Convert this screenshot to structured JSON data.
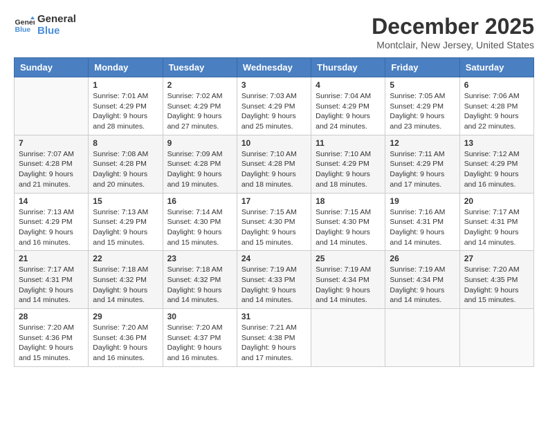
{
  "header": {
    "logo_line1": "General",
    "logo_line2": "Blue",
    "month": "December 2025",
    "location": "Montclair, New Jersey, United States"
  },
  "weekdays": [
    "Sunday",
    "Monday",
    "Tuesday",
    "Wednesday",
    "Thursday",
    "Friday",
    "Saturday"
  ],
  "weeks": [
    [
      {
        "day": "",
        "sunrise": "",
        "sunset": "",
        "daylight": ""
      },
      {
        "day": "1",
        "sunrise": "Sunrise: 7:01 AM",
        "sunset": "Sunset: 4:29 PM",
        "daylight": "Daylight: 9 hours and 28 minutes."
      },
      {
        "day": "2",
        "sunrise": "Sunrise: 7:02 AM",
        "sunset": "Sunset: 4:29 PM",
        "daylight": "Daylight: 9 hours and 27 minutes."
      },
      {
        "day": "3",
        "sunrise": "Sunrise: 7:03 AM",
        "sunset": "Sunset: 4:29 PM",
        "daylight": "Daylight: 9 hours and 25 minutes."
      },
      {
        "day": "4",
        "sunrise": "Sunrise: 7:04 AM",
        "sunset": "Sunset: 4:29 PM",
        "daylight": "Daylight: 9 hours and 24 minutes."
      },
      {
        "day": "5",
        "sunrise": "Sunrise: 7:05 AM",
        "sunset": "Sunset: 4:29 PM",
        "daylight": "Daylight: 9 hours and 23 minutes."
      },
      {
        "day": "6",
        "sunrise": "Sunrise: 7:06 AM",
        "sunset": "Sunset: 4:28 PM",
        "daylight": "Daylight: 9 hours and 22 minutes."
      }
    ],
    [
      {
        "day": "7",
        "sunrise": "Sunrise: 7:07 AM",
        "sunset": "Sunset: 4:28 PM",
        "daylight": "Daylight: 9 hours and 21 minutes."
      },
      {
        "day": "8",
        "sunrise": "Sunrise: 7:08 AM",
        "sunset": "Sunset: 4:28 PM",
        "daylight": "Daylight: 9 hours and 20 minutes."
      },
      {
        "day": "9",
        "sunrise": "Sunrise: 7:09 AM",
        "sunset": "Sunset: 4:28 PM",
        "daylight": "Daylight: 9 hours and 19 minutes."
      },
      {
        "day": "10",
        "sunrise": "Sunrise: 7:10 AM",
        "sunset": "Sunset: 4:28 PM",
        "daylight": "Daylight: 9 hours and 18 minutes."
      },
      {
        "day": "11",
        "sunrise": "Sunrise: 7:10 AM",
        "sunset": "Sunset: 4:29 PM",
        "daylight": "Daylight: 9 hours and 18 minutes."
      },
      {
        "day": "12",
        "sunrise": "Sunrise: 7:11 AM",
        "sunset": "Sunset: 4:29 PM",
        "daylight": "Daylight: 9 hours and 17 minutes."
      },
      {
        "day": "13",
        "sunrise": "Sunrise: 7:12 AM",
        "sunset": "Sunset: 4:29 PM",
        "daylight": "Daylight: 9 hours and 16 minutes."
      }
    ],
    [
      {
        "day": "14",
        "sunrise": "Sunrise: 7:13 AM",
        "sunset": "Sunset: 4:29 PM",
        "daylight": "Daylight: 9 hours and 16 minutes."
      },
      {
        "day": "15",
        "sunrise": "Sunrise: 7:13 AM",
        "sunset": "Sunset: 4:29 PM",
        "daylight": "Daylight: 9 hours and 15 minutes."
      },
      {
        "day": "16",
        "sunrise": "Sunrise: 7:14 AM",
        "sunset": "Sunset: 4:30 PM",
        "daylight": "Daylight: 9 hours and 15 minutes."
      },
      {
        "day": "17",
        "sunrise": "Sunrise: 7:15 AM",
        "sunset": "Sunset: 4:30 PM",
        "daylight": "Daylight: 9 hours and 15 minutes."
      },
      {
        "day": "18",
        "sunrise": "Sunrise: 7:15 AM",
        "sunset": "Sunset: 4:30 PM",
        "daylight": "Daylight: 9 hours and 14 minutes."
      },
      {
        "day": "19",
        "sunrise": "Sunrise: 7:16 AM",
        "sunset": "Sunset: 4:31 PM",
        "daylight": "Daylight: 9 hours and 14 minutes."
      },
      {
        "day": "20",
        "sunrise": "Sunrise: 7:17 AM",
        "sunset": "Sunset: 4:31 PM",
        "daylight": "Daylight: 9 hours and 14 minutes."
      }
    ],
    [
      {
        "day": "21",
        "sunrise": "Sunrise: 7:17 AM",
        "sunset": "Sunset: 4:31 PM",
        "daylight": "Daylight: 9 hours and 14 minutes."
      },
      {
        "day": "22",
        "sunrise": "Sunrise: 7:18 AM",
        "sunset": "Sunset: 4:32 PM",
        "daylight": "Daylight: 9 hours and 14 minutes."
      },
      {
        "day": "23",
        "sunrise": "Sunrise: 7:18 AM",
        "sunset": "Sunset: 4:32 PM",
        "daylight": "Daylight: 9 hours and 14 minutes."
      },
      {
        "day": "24",
        "sunrise": "Sunrise: 7:19 AM",
        "sunset": "Sunset: 4:33 PM",
        "daylight": "Daylight: 9 hours and 14 minutes."
      },
      {
        "day": "25",
        "sunrise": "Sunrise: 7:19 AM",
        "sunset": "Sunset: 4:34 PM",
        "daylight": "Daylight: 9 hours and 14 minutes."
      },
      {
        "day": "26",
        "sunrise": "Sunrise: 7:19 AM",
        "sunset": "Sunset: 4:34 PM",
        "daylight": "Daylight: 9 hours and 14 minutes."
      },
      {
        "day": "27",
        "sunrise": "Sunrise: 7:20 AM",
        "sunset": "Sunset: 4:35 PM",
        "daylight": "Daylight: 9 hours and 15 minutes."
      }
    ],
    [
      {
        "day": "28",
        "sunrise": "Sunrise: 7:20 AM",
        "sunset": "Sunset: 4:36 PM",
        "daylight": "Daylight: 9 hours and 15 minutes."
      },
      {
        "day": "29",
        "sunrise": "Sunrise: 7:20 AM",
        "sunset": "Sunset: 4:36 PM",
        "daylight": "Daylight: 9 hours and 16 minutes."
      },
      {
        "day": "30",
        "sunrise": "Sunrise: 7:20 AM",
        "sunset": "Sunset: 4:37 PM",
        "daylight": "Daylight: 9 hours and 16 minutes."
      },
      {
        "day": "31",
        "sunrise": "Sunrise: 7:21 AM",
        "sunset": "Sunset: 4:38 PM",
        "daylight": "Daylight: 9 hours and 17 minutes."
      },
      {
        "day": "",
        "sunrise": "",
        "sunset": "",
        "daylight": ""
      },
      {
        "day": "",
        "sunrise": "",
        "sunset": "",
        "daylight": ""
      },
      {
        "day": "",
        "sunrise": "",
        "sunset": "",
        "daylight": ""
      }
    ]
  ]
}
